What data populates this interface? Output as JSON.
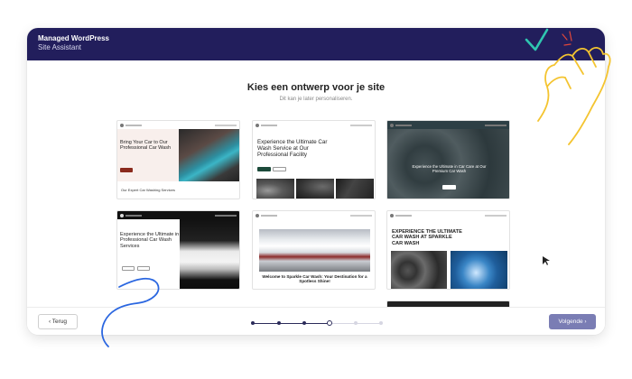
{
  "header": {
    "brand_line1": "Managed WordPress",
    "brand_line2": "Site Assistant"
  },
  "main": {
    "title": "Kies een ontwerp voor je site",
    "subtitle": "Dit kan je later personaliseren."
  },
  "templates": [
    {
      "title": "Bring Your Car to Our Professional Car Wash",
      "section": "Our Expert Car Washing Services"
    },
    {
      "title": "Experience the Ultimate Car Wash Service at Our Professional Facility"
    },
    {
      "title": "Experience the Ultimate in Car Care at Our Premium Car Wash"
    },
    {
      "title": "Experience the Ultimate in Professional Car Wash Services"
    },
    {
      "title": "Welcome to Sparkle Car Wash: Your Destination for a Spotless Shine!"
    },
    {
      "title": "EXPERIENCE THE ULTIMATE CAR WASH AT SPARKLE CAR WASH"
    }
  ],
  "footer": {
    "back_label": "‹ Terug",
    "next_label": "Volgende ›",
    "steps_total": 6,
    "steps_current": 4
  },
  "colors": {
    "header_bg": "#221e5c",
    "next_button": "#7a7db4",
    "annotation_green": "#2fc6b0",
    "annotation_yellow": "#f4c430",
    "annotation_blue": "#2a66e0",
    "annotation_red": "#e0473a"
  }
}
